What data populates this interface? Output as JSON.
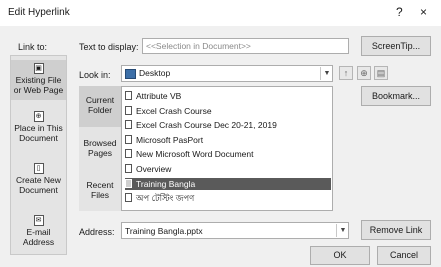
{
  "window": {
    "title": "Edit Hyperlink",
    "help": "?",
    "close": "×"
  },
  "link_to": {
    "label": "Link to:",
    "items": [
      {
        "icon": "web-page-icon",
        "glyph": "▣",
        "line1": "Existing File",
        "line2": "or Web Page"
      },
      {
        "icon": "place-icon",
        "glyph": "⊕",
        "line1": "Place in This",
        "line2": "Document"
      },
      {
        "icon": "new-document-icon",
        "glyph": "▯",
        "line1": "Create New",
        "line2": "Document"
      },
      {
        "icon": "email-icon",
        "glyph": "✉",
        "line1": "E-mail",
        "line2": "Address"
      }
    ]
  },
  "text_to_display": {
    "label": "Text to display:",
    "value": "<<Selection in Document>>"
  },
  "screentip_button": "ScreenTip...",
  "look_in": {
    "label": "Look in:",
    "value": "Desktop"
  },
  "side_nav": [
    {
      "line1": "Current",
      "line2": "Folder"
    },
    {
      "line1": "Browsed",
      "line2": "Pages"
    },
    {
      "line1": "Recent",
      "line2": "Files"
    }
  ],
  "files": [
    "Attribute VB",
    "Excel Crash Course",
    "Excel Crash Course Dec 20-21, 2019",
    "Microsoft PasPort",
    "New Microsoft Word Document",
    "Overview",
    "Training Bangla",
    "অপ টেস্টিং জপণ"
  ],
  "selected_file_index": 6,
  "bookmark_button": "Bookmark...",
  "address": {
    "label": "Address:",
    "value": "Training Bangla.pptx"
  },
  "remove_link_button": "Remove Link",
  "ok_button": "OK",
  "cancel_button": "Cancel"
}
